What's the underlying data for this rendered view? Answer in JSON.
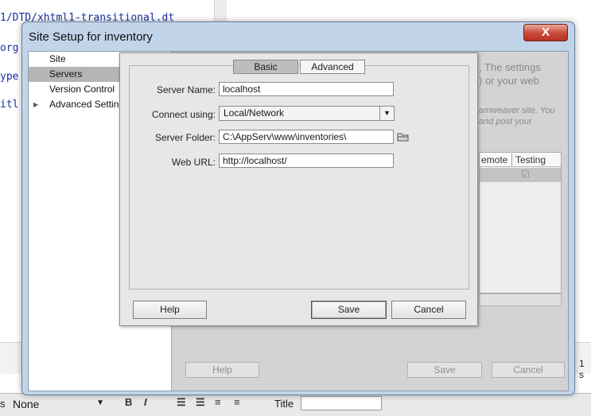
{
  "editor": {
    "code_lines": [
      "1/DTD/xhtml1-transitional.dt",
      "org",
      "ype",
      "itl"
    ]
  },
  "background": {
    "right_edge_text": "1 s"
  },
  "properties": {
    "prefix_label": "s",
    "format_value": "None",
    "title_label": "Title"
  },
  "window": {
    "title": "Site Setup for inventory",
    "close_symbol": "X",
    "categories": [
      {
        "label": "Site",
        "selected": false
      },
      {
        "label": "Servers",
        "selected": true
      },
      {
        "label": "Version Control",
        "selected": false
      },
      {
        "label": "Advanced Settings",
        "selected": false,
        "expandable": true
      }
    ],
    "background_panel": {
      "desc_lines": [
        ", The settings",
        ") or your web"
      ],
      "italic_lines": [
        "amweaver site. You",
        "and post your"
      ],
      "table_headers": [
        "emote",
        "Testing"
      ],
      "checkbox_symbol": "☑",
      "help_label": "Help",
      "save_label": "Save",
      "cancel_label": "Cancel"
    }
  },
  "server_dialog": {
    "tabs": [
      {
        "label": "Basic",
        "active": true
      },
      {
        "label": "Advanced",
        "active": false
      }
    ],
    "server_name": {
      "label": "Server Name:",
      "value": "localhost"
    },
    "connect_using": {
      "label": "Connect using:",
      "value": "Local/Network"
    },
    "server_folder": {
      "label": "Server Folder:",
      "value": "C:\\AppServ\\www\\inventories\\"
    },
    "web_url": {
      "label": "Web URL:",
      "value": "http://localhost/"
    },
    "help_label": "Help",
    "save_label": "Save",
    "cancel_label": "Cancel"
  }
}
